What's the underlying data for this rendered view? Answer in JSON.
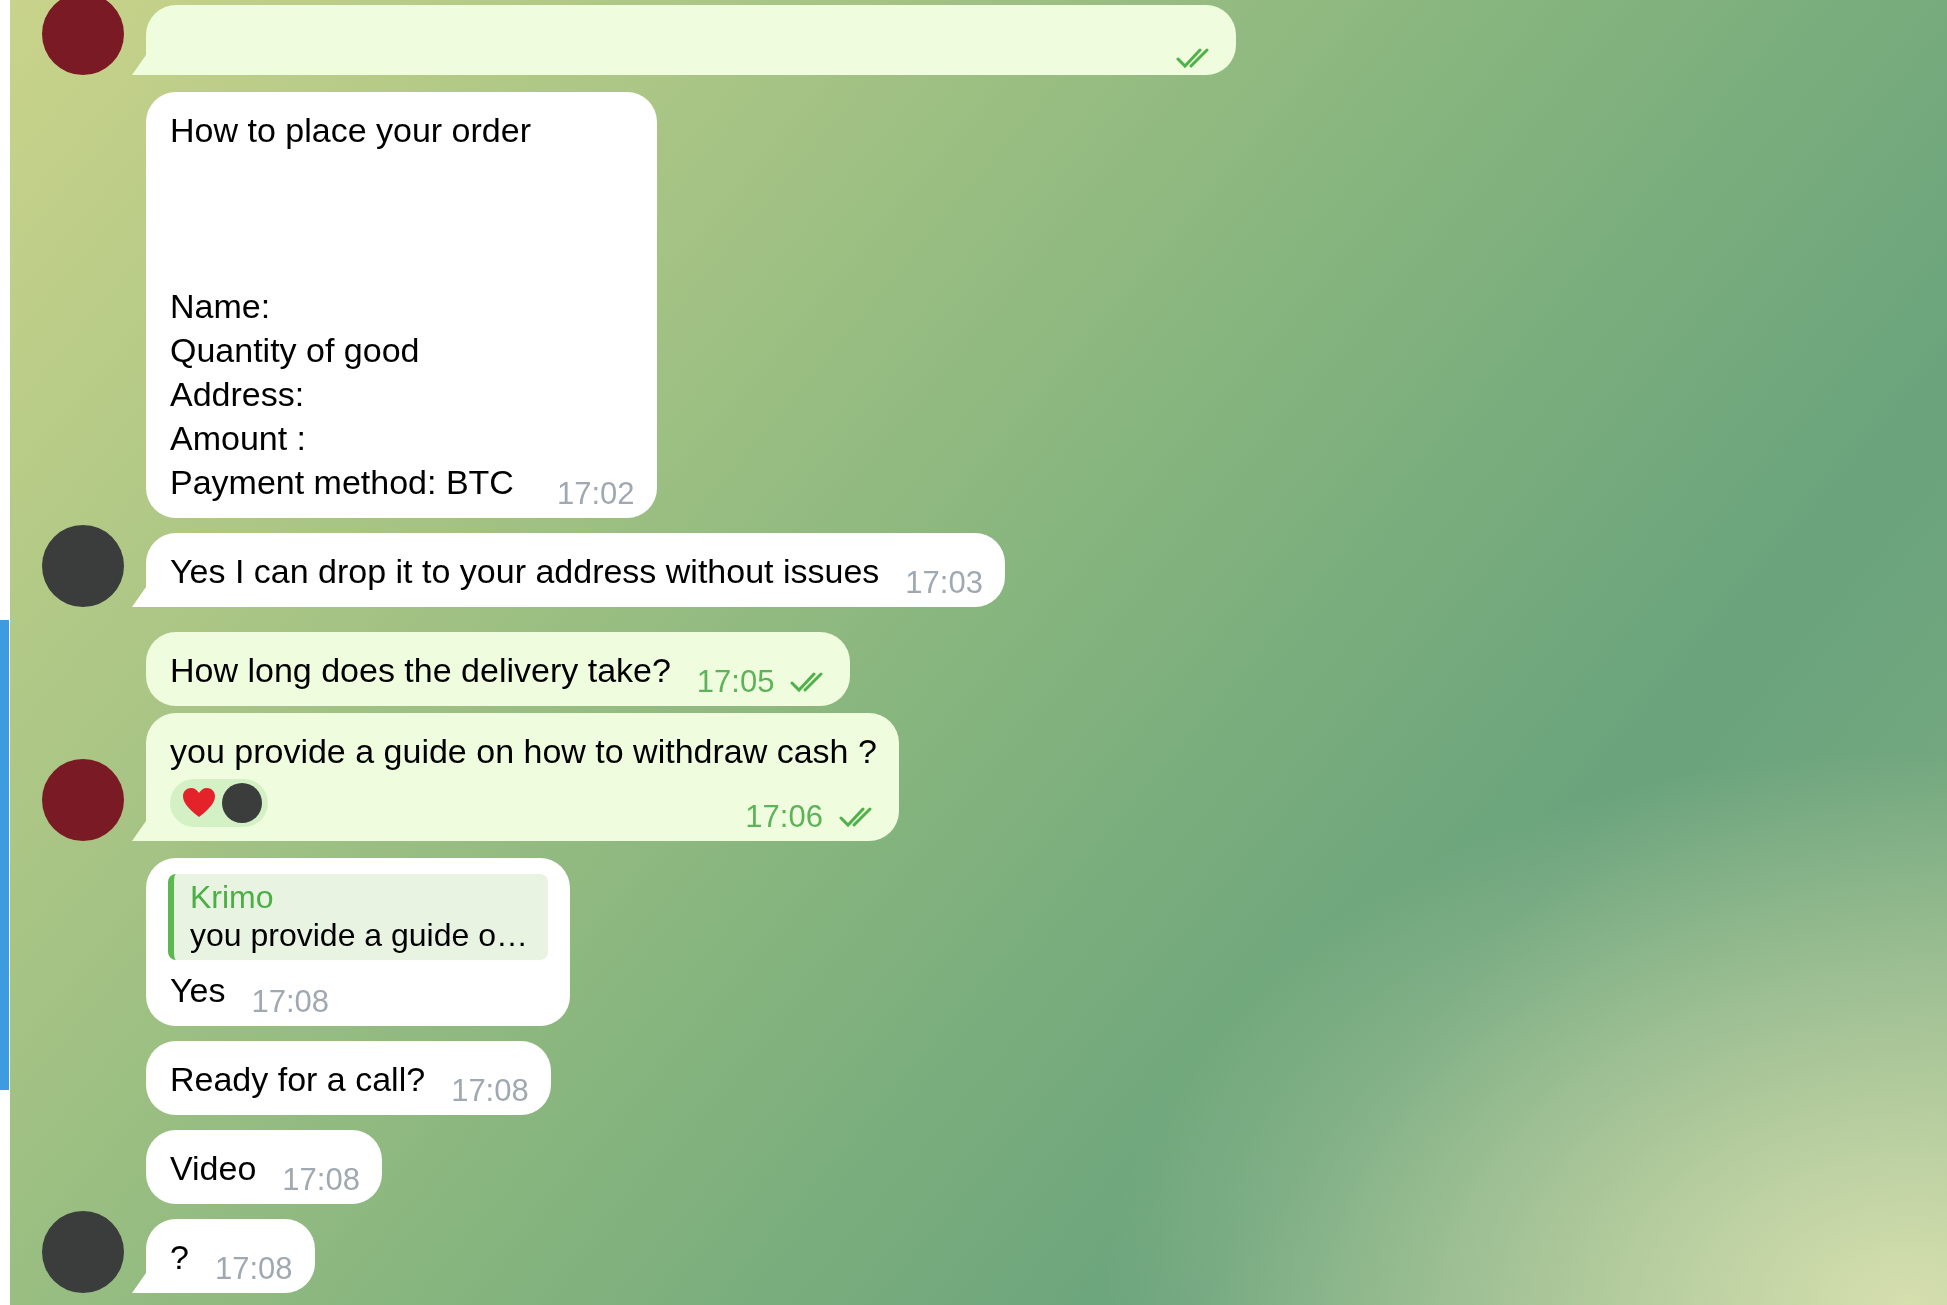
{
  "messages": [
    {
      "outgoing": true,
      "read": true,
      "avatar": true
    },
    {
      "outgoing": false,
      "text": "How to place your order\n\n\n\nName:\nQuantity of good\nAddress:\nAmount :\nPayment method: BTC",
      "time": "17:02",
      "avatar": false
    },
    {
      "outgoing": false,
      "text": "Yes I can drop it to your address without issues",
      "time": "17:03",
      "avatar": true
    },
    {
      "outgoing": true,
      "text": "How long does the delivery take?",
      "time": "17:05",
      "read": true,
      "avatar": false
    },
    {
      "outgoing": true,
      "text": "you provide a guide on how to withdraw cash ?",
      "time": "17:06",
      "read": true,
      "avatar": true,
      "reactions": [
        {
          "kind": "heart"
        }
      ]
    },
    {
      "outgoing": false,
      "reply": {
        "name": "Krimo",
        "text": "you provide a guide o…"
      },
      "text": "Yes",
      "time": "17:08",
      "avatar": false
    },
    {
      "outgoing": false,
      "text": "Ready for a call?",
      "time": "17:08",
      "avatar": false
    },
    {
      "outgoing": false,
      "text": "Video",
      "time": "17:08",
      "avatar": false
    },
    {
      "outgoing": false,
      "text": "?",
      "time": "17:08",
      "avatar": true
    }
  ]
}
